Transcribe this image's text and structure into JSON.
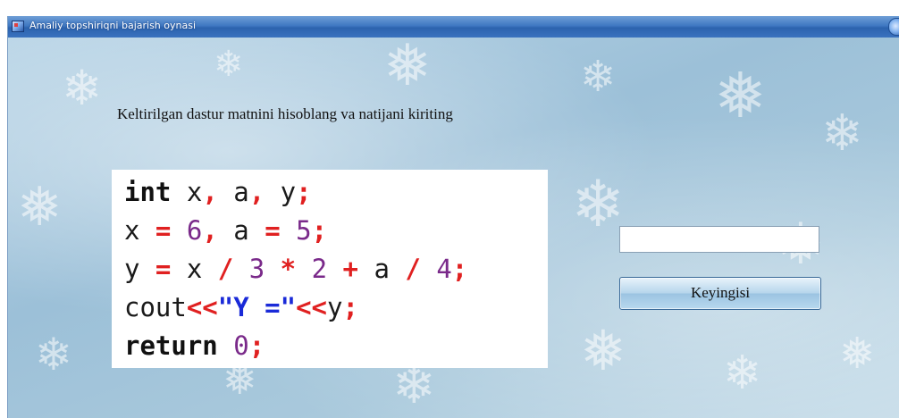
{
  "window": {
    "title": "Amaliy topshiriqni bajarish oynasi"
  },
  "task": {
    "instruction": "Keltirilgan dastur matnini hisoblang va natijani kiriting"
  },
  "code": {
    "lines": [
      [
        {
          "t": "int",
          "c": "kw"
        },
        {
          "t": " x",
          "c": ""
        },
        {
          "t": ",",
          "c": "op"
        },
        {
          "t": " a",
          "c": ""
        },
        {
          "t": ",",
          "c": "op"
        },
        {
          "t": " y",
          "c": ""
        },
        {
          "t": ";",
          "c": "op"
        }
      ],
      [
        {
          "t": "x ",
          "c": ""
        },
        {
          "t": "=",
          "c": "op"
        },
        {
          "t": " ",
          "c": ""
        },
        {
          "t": "6",
          "c": "num"
        },
        {
          "t": ",",
          "c": "op"
        },
        {
          "t": " a ",
          "c": ""
        },
        {
          "t": "=",
          "c": "op"
        },
        {
          "t": " ",
          "c": ""
        },
        {
          "t": "5",
          "c": "num"
        },
        {
          "t": ";",
          "c": "op"
        }
      ],
      [
        {
          "t": "y ",
          "c": ""
        },
        {
          "t": "=",
          "c": "op"
        },
        {
          "t": " x ",
          "c": ""
        },
        {
          "t": "/",
          "c": "op"
        },
        {
          "t": " ",
          "c": ""
        },
        {
          "t": "3",
          "c": "num"
        },
        {
          "t": " ",
          "c": ""
        },
        {
          "t": "*",
          "c": "op"
        },
        {
          "t": " ",
          "c": ""
        },
        {
          "t": "2",
          "c": "num"
        },
        {
          "t": " ",
          "c": ""
        },
        {
          "t": "+",
          "c": "op"
        },
        {
          "t": " a ",
          "c": ""
        },
        {
          "t": "/",
          "c": "op"
        },
        {
          "t": " ",
          "c": ""
        },
        {
          "t": "4",
          "c": "num"
        },
        {
          "t": ";",
          "c": "op"
        }
      ],
      [
        {
          "t": "cout",
          "c": ""
        },
        {
          "t": "<<",
          "c": "op"
        },
        {
          "t": "\"Y =\"",
          "c": "str"
        },
        {
          "t": "<<",
          "c": "op"
        },
        {
          "t": "y",
          "c": ""
        },
        {
          "t": ";",
          "c": "op"
        }
      ],
      [
        {
          "t": "return",
          "c": "kw"
        },
        {
          "t": " ",
          "c": ""
        },
        {
          "t": "0",
          "c": "num"
        },
        {
          "t": ";",
          "c": "op"
        }
      ]
    ]
  },
  "answer": {
    "value": "",
    "placeholder": ""
  },
  "buttons": {
    "next_label": "Keyingisi"
  },
  "icons": {
    "app_icon": "app-window-icon",
    "title_button": "minimize-orb-icon"
  },
  "colors": {
    "titlebar": "#3f78c2",
    "background": "#a9c9dc",
    "code_operator": "#e02020",
    "code_number": "#7a2a8a",
    "code_string": "#1a2ad8"
  }
}
